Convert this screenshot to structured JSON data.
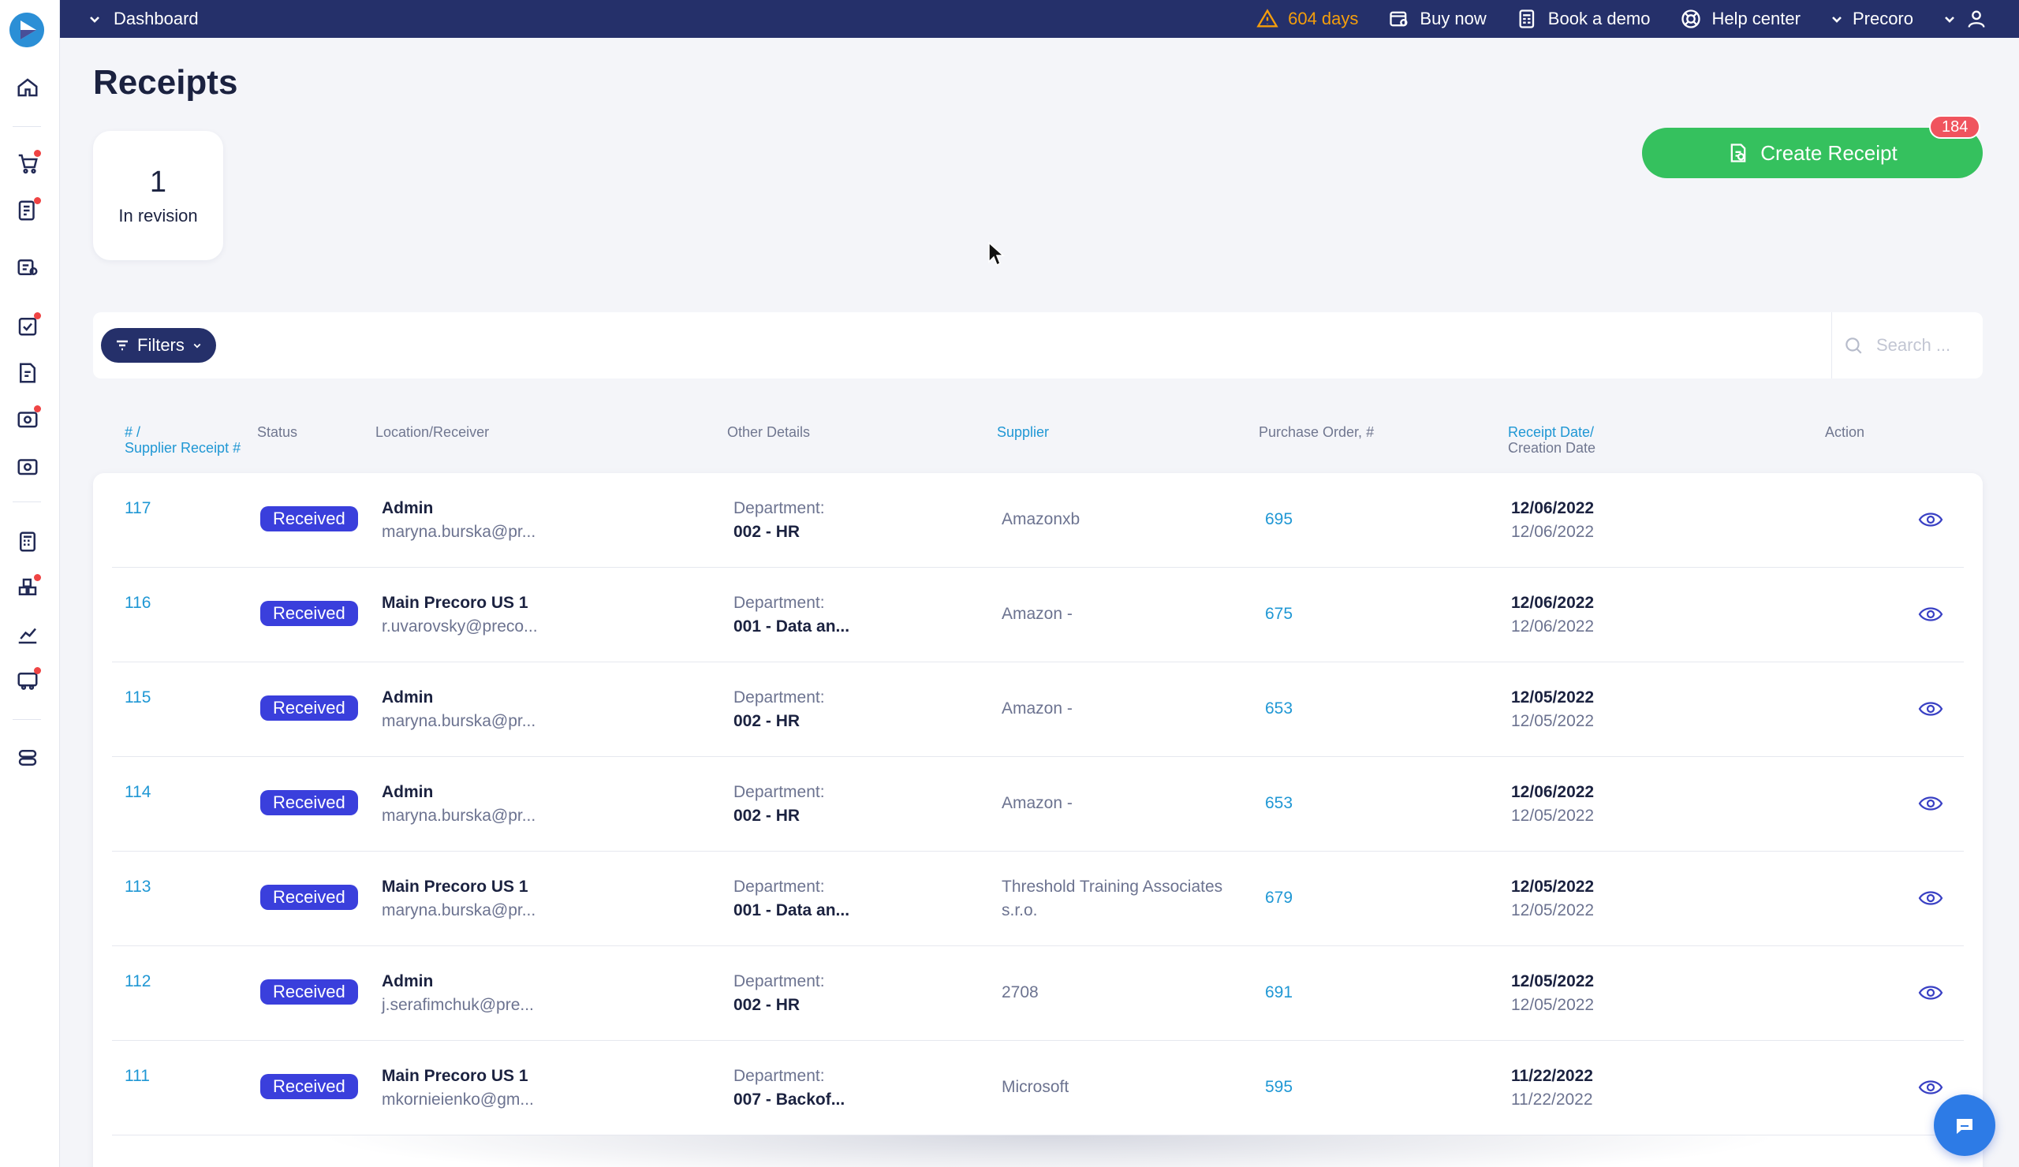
{
  "topbar": {
    "breadcrumb": "Dashboard",
    "trial_days": "604 days",
    "buy_now": "Buy now",
    "book_demo": "Book a demo",
    "help_center": "Help center",
    "company": "Precoro"
  },
  "page": {
    "title": "Receipts",
    "revision_count": "1",
    "revision_label": "In revision",
    "create_button": "Create Receipt",
    "create_badge": "184"
  },
  "filters": {
    "button_label": "Filters",
    "search_placeholder": "Search ..."
  },
  "table": {
    "headers": {
      "id_line1": "# /",
      "id_line2": "Supplier Receipt #",
      "status": "Status",
      "location": "Location/Receiver",
      "other": "Other Details",
      "supplier": "Supplier",
      "po": "Purchase Order, #",
      "date_line1": "Receipt Date/",
      "date_line2": "Creation Date",
      "action": "Action"
    },
    "rows": [
      {
        "id": "117",
        "status": "Received",
        "location": "Admin",
        "receiver": "maryna.burska@pr...",
        "dept_label": "Department:",
        "dept": "002 - HR",
        "supplier": "Amazonxb",
        "po": "695",
        "receipt_date": "12/06/2022",
        "created_date": "12/06/2022"
      },
      {
        "id": "116",
        "status": "Received",
        "location": "Main Precoro US 1",
        "receiver": "r.uvarovsky@preco...",
        "dept_label": "Department:",
        "dept": "001 - Data an...",
        "supplier": "Amazon -",
        "po": "675",
        "receipt_date": "12/06/2022",
        "created_date": "12/06/2022"
      },
      {
        "id": "115",
        "status": "Received",
        "location": "Admin",
        "receiver": "maryna.burska@pr...",
        "dept_label": "Department:",
        "dept": "002 - HR",
        "supplier": "Amazon -",
        "po": "653",
        "receipt_date": "12/05/2022",
        "created_date": "12/05/2022"
      },
      {
        "id": "114",
        "status": "Received",
        "location": "Admin",
        "receiver": "maryna.burska@pr...",
        "dept_label": "Department:",
        "dept": "002 - HR",
        "supplier": "Amazon -",
        "po": "653",
        "receipt_date": "12/06/2022",
        "created_date": "12/05/2022"
      },
      {
        "id": "113",
        "status": "Received",
        "location": "Main Precoro US 1",
        "receiver": "maryna.burska@pr...",
        "dept_label": "Department:",
        "dept": "001 - Data an...",
        "supplier": "Threshold Training Associates s.r.o.",
        "po": "679",
        "receipt_date": "12/05/2022",
        "created_date": "12/05/2022"
      },
      {
        "id": "112",
        "status": "Received",
        "location": "Admin",
        "receiver": "j.serafimchuk@pre...",
        "dept_label": "Department:",
        "dept": "002 - HR",
        "supplier": "2708",
        "po": "691",
        "receipt_date": "12/05/2022",
        "created_date": "12/05/2022"
      },
      {
        "id": "111",
        "status": "Received",
        "location": "Main Precoro US 1",
        "receiver": "mkornieienko@gm...",
        "dept_label": "Department:",
        "dept": "007 - Backof...",
        "supplier": "Microsoft",
        "po": "595",
        "receipt_date": "11/22/2022",
        "created_date": "11/22/2022"
      }
    ]
  },
  "colors": {
    "topbar": "#25306a",
    "accent_green": "#35c15e",
    "status_badge": "#3a3fdc",
    "link_blue": "#1f97d4",
    "warning": "#f59e0b",
    "badge_red": "#f0545e"
  }
}
